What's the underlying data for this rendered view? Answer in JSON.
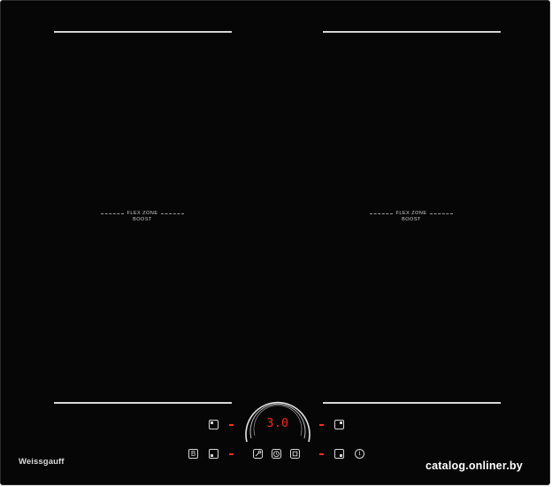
{
  "zones": {
    "left": {
      "line1": "FLEX ZONE",
      "line2": "BOOST"
    },
    "right": {
      "line1": "FLEX ZONE",
      "line2": "BOOST"
    }
  },
  "display": {
    "value": "3.0",
    "color": "#ff2a1a"
  },
  "controls": {
    "booster_key": "B",
    "info_key": "i"
  },
  "brand": {
    "name": "Weissgauff"
  },
  "watermark": {
    "text": "catalog.onliner.by"
  },
  "colors": {
    "surface": "#060606",
    "indicator": "#ff2a1a",
    "markings": "#d8d8d8"
  },
  "icons": [
    "zone-top-left-icon",
    "zone-top-right-icon",
    "zone-bottom-left-icon",
    "zone-bottom-right-icon",
    "lock-key-icon",
    "timer-icon",
    "stop-icon"
  ]
}
